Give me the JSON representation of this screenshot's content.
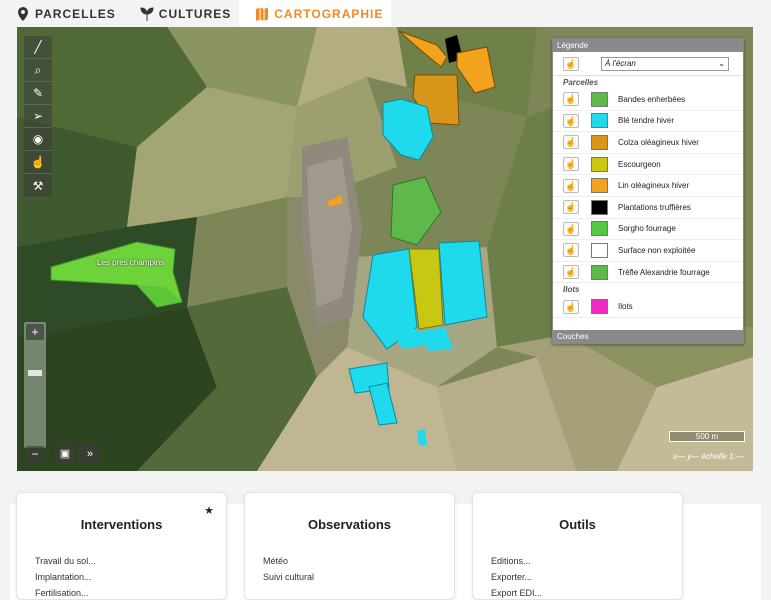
{
  "tabs": [
    {
      "label": "PARCELLES",
      "icon": "map-pin-icon"
    },
    {
      "label": "CULTURES",
      "icon": "sprout-icon"
    },
    {
      "label": "CARTOGRAPHIE",
      "icon": "map-icon"
    }
  ],
  "map": {
    "parcel_label": "Les pres champins",
    "scale": "500 m",
    "coords": "x— y— échelle 1:—"
  },
  "legend": {
    "header": "Légende",
    "footer": "Couches",
    "select_value": "À l'écran",
    "groups": [
      {
        "title": "Parcelles",
        "items": [
          {
            "label": "Bandes enherbées",
            "color": "#5fb84a"
          },
          {
            "label": "Blé tendre hiver",
            "color": "#1fd9ec"
          },
          {
            "label": "Colza oléagineux hiver",
            "color": "#d8961a"
          },
          {
            "label": "Escourgeon",
            "color": "#c8c814"
          },
          {
            "label": "Lin oléagineux hiver",
            "color": "#f3a21d"
          },
          {
            "label": "Plantations truffières",
            "color": "#000000"
          },
          {
            "label": "Sorgho fourrage",
            "color": "#55c844"
          },
          {
            "label": "Surface non exploitée",
            "color": "#ffffff"
          },
          {
            "label": "Trèfle Alexandrie fourrage",
            "color": "#5fb84a"
          }
        ]
      },
      {
        "title": "Ilots",
        "items": [
          {
            "label": "Ilots",
            "color": "#f02cc0"
          }
        ]
      }
    ]
  },
  "cards": [
    {
      "title": "Interventions",
      "items": [
        "Travail du sol...",
        "Implantation...",
        "Fertilisation..."
      ],
      "starred": true
    },
    {
      "title": "Observations",
      "items": [
        "Météo",
        "Suivi cultural"
      ],
      "starred": false
    },
    {
      "title": "Outils",
      "items": [
        "Editions...",
        "Exporter...",
        "Export EDI..."
      ],
      "starred": false
    }
  ]
}
